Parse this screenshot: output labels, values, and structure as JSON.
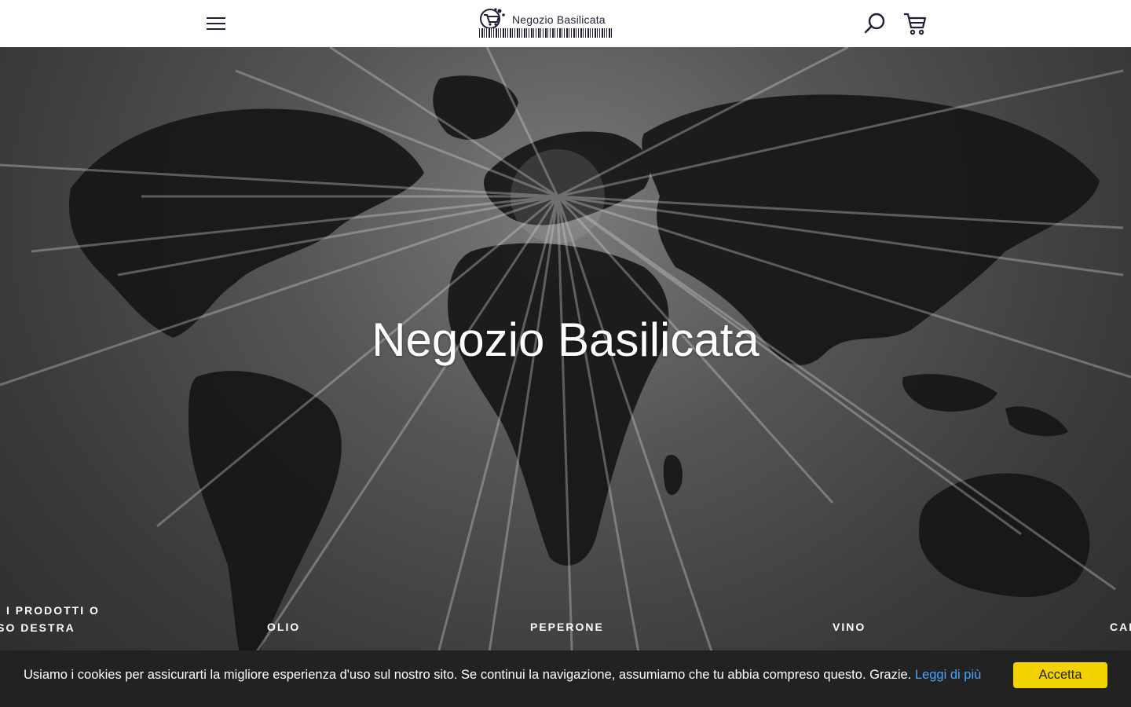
{
  "header": {
    "logo_text": "Negozio Basilicata",
    "menu_icon": "hamburger-icon",
    "search_icon": "search-icon",
    "cart_icon": "cart-icon"
  },
  "hero": {
    "title": "Negozio Basilicata",
    "categories": [
      {
        "line1": "I PRODOTTI O",
        "line2": "RSO DESTRA"
      },
      {
        "label": "OLIO"
      },
      {
        "label": "PEPERONE"
      },
      {
        "label": "VINO"
      },
      {
        "label": "CAR"
      }
    ]
  },
  "cookie_bar": {
    "message": "Usiamo i cookies per assicurarti la migliore esperienza d'uso sul nostro sito. Se continui la navigazione, assumiamo che tu abbia compreso questo. Grazie.",
    "link_text": "Leggi di più",
    "accept_label": "Accetta"
  },
  "colors": {
    "header_bg": "#ffffff",
    "brand_dark": "#1f1f3a",
    "cookie_bg": "#222222",
    "accept_bg": "#f2d300",
    "link": "#4aa3ff"
  }
}
